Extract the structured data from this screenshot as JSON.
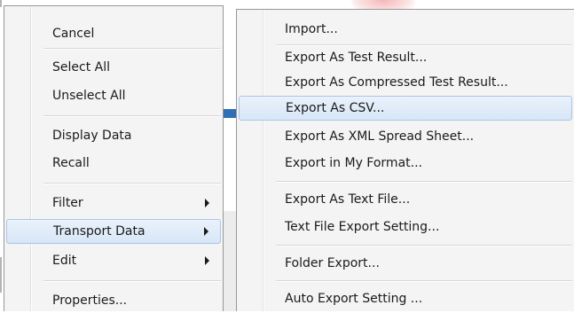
{
  "left_menu": {
    "items": [
      {
        "label": "Cancel",
        "submenu": false,
        "highlighted": false
      },
      {
        "label": "Select All",
        "submenu": false,
        "highlighted": false
      },
      {
        "label": "Unselect All",
        "submenu": false,
        "highlighted": false
      },
      {
        "label": "Display Data",
        "submenu": false,
        "highlighted": false
      },
      {
        "label": "Recall",
        "submenu": false,
        "highlighted": false
      },
      {
        "label": "Filter",
        "submenu": true,
        "highlighted": false
      },
      {
        "label": "Transport Data",
        "submenu": true,
        "highlighted": true
      },
      {
        "label": "Edit",
        "submenu": true,
        "highlighted": false
      },
      {
        "label": "Properties...",
        "submenu": false,
        "highlighted": false
      }
    ]
  },
  "right_menu": {
    "items": [
      {
        "label": "Import...",
        "highlighted": false
      },
      {
        "label": "Export As Test Result...",
        "highlighted": false
      },
      {
        "label": "Export As Compressed Test Result...",
        "highlighted": false
      },
      {
        "label": "Export As CSV...",
        "highlighted": true
      },
      {
        "label": "Export As XML Spread Sheet...",
        "highlighted": false
      },
      {
        "label": "Export in My Format...",
        "highlighted": false
      },
      {
        "label": "Export As Text File...",
        "highlighted": false
      },
      {
        "label": "Text File Export Setting...",
        "highlighted": false
      },
      {
        "label": "Folder Export...",
        "highlighted": false
      },
      {
        "label": "Auto Export Setting ...",
        "highlighted": false
      }
    ]
  },
  "colors": {
    "menu_background": "#f4f4f4",
    "highlight_border": "#a9c6e6",
    "highlight_fill": "#d7e6f7",
    "text": "#1a1a1a"
  },
  "icons": {
    "submenu_arrow": "triangle-right"
  }
}
